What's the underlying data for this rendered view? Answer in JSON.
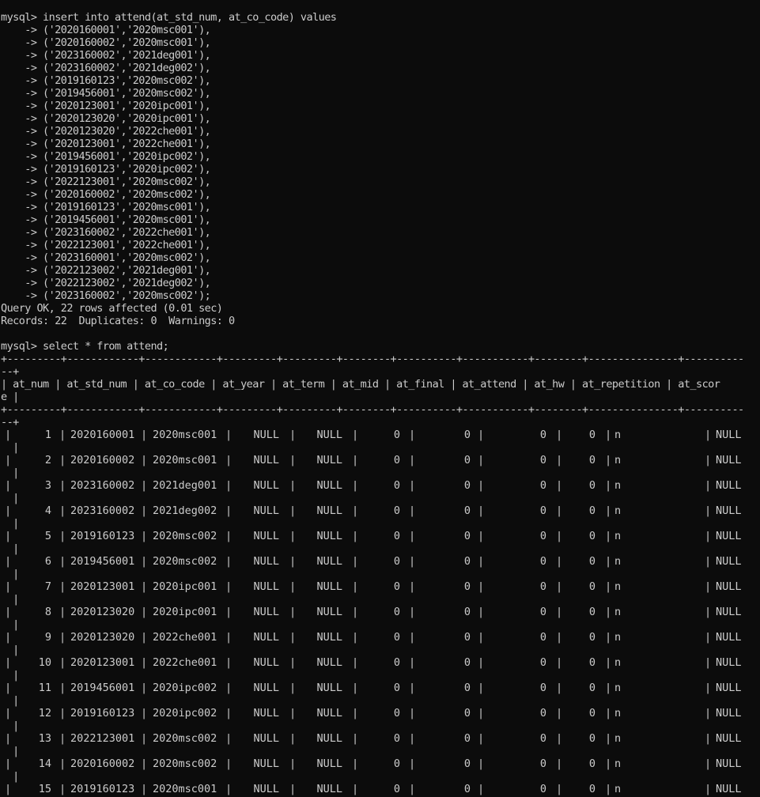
{
  "insert": {
    "prompt_line": "mysql> insert into attend(at_std_num, at_co_code) values",
    "value_lines": [
      "    -> ('2020160001','2020msc001'),",
      "    -> ('2020160002','2020msc001'),",
      "    -> ('2023160002','2021deg001'),",
      "    -> ('2023160002','2021deg002'),",
      "    -> ('2019160123','2020msc002'),",
      "    -> ('2019456001','2020msc002'),",
      "    -> ('2020123001','2020ipc001'),",
      "    -> ('2020123020','2020ipc001'),",
      "    -> ('2020123020','2022che001'),",
      "    -> ('2020123001','2022che001'),",
      "    -> ('2019456001','2020ipc002'),",
      "    -> ('2019160123','2020ipc002'),",
      "    -> ('2022123001','2020msc002'),",
      "    -> ('2020160002','2020msc002'),",
      "    -> ('2019160123','2020msc001'),",
      "    -> ('2019456001','2020msc001'),",
      "    -> ('2023160002','2022che001'),",
      "    -> ('2022123001','2022che001'),",
      "    -> ('2023160001','2020msc002'),",
      "    -> ('2022123002','2021deg001'),",
      "    -> ('2022123002','2021deg002'),",
      "    -> ('2023160002','2020msc002');"
    ],
    "result": "Query OK, 22 rows affected (0.01 sec)",
    "records": "Records: 22  Duplicates: 0  Warnings: 0"
  },
  "select": {
    "prompt_line": "mysql> select * from attend;",
    "border_line": "+---------+------------+------------+---------+---------+--------+----------+-----------+--------+---------------+----------",
    "border_wrap": "--+",
    "header_line": "| at_num | at_std_num | at_co_code | at_year | at_term | at_mid | at_final | at_attend | at_hw | at_repetition | at_scor",
    "header_wrap": "e |",
    "row_wrap": "  |",
    "rows": [
      [
        "1",
        "2020160001",
        "2020msc001",
        "NULL",
        "NULL",
        "0",
        "0",
        "0",
        "0",
        "n",
        "NULL"
      ],
      [
        "2",
        "2020160002",
        "2020msc001",
        "NULL",
        "NULL",
        "0",
        "0",
        "0",
        "0",
        "n",
        "NULL"
      ],
      [
        "3",
        "2023160002",
        "2021deg001",
        "NULL",
        "NULL",
        "0",
        "0",
        "0",
        "0",
        "n",
        "NULL"
      ],
      [
        "4",
        "2023160002",
        "2021deg002",
        "NULL",
        "NULL",
        "0",
        "0",
        "0",
        "0",
        "n",
        "NULL"
      ],
      [
        "5",
        "2019160123",
        "2020msc002",
        "NULL",
        "NULL",
        "0",
        "0",
        "0",
        "0",
        "n",
        "NULL"
      ],
      [
        "6",
        "2019456001",
        "2020msc002",
        "NULL",
        "NULL",
        "0",
        "0",
        "0",
        "0",
        "n",
        "NULL"
      ],
      [
        "7",
        "2020123001",
        "2020ipc001",
        "NULL",
        "NULL",
        "0",
        "0",
        "0",
        "0",
        "n",
        "NULL"
      ],
      [
        "8",
        "2020123020",
        "2020ipc001",
        "NULL",
        "NULL",
        "0",
        "0",
        "0",
        "0",
        "n",
        "NULL"
      ],
      [
        "9",
        "2020123020",
        "2022che001",
        "NULL",
        "NULL",
        "0",
        "0",
        "0",
        "0",
        "n",
        "NULL"
      ],
      [
        "10",
        "2020123001",
        "2022che001",
        "NULL",
        "NULL",
        "0",
        "0",
        "0",
        "0",
        "n",
        "NULL"
      ],
      [
        "11",
        "2019456001",
        "2020ipc002",
        "NULL",
        "NULL",
        "0",
        "0",
        "0",
        "0",
        "n",
        "NULL"
      ],
      [
        "12",
        "2019160123",
        "2020ipc002",
        "NULL",
        "NULL",
        "0",
        "0",
        "0",
        "0",
        "n",
        "NULL"
      ],
      [
        "13",
        "2022123001",
        "2020msc002",
        "NULL",
        "NULL",
        "0",
        "0",
        "0",
        "0",
        "n",
        "NULL"
      ],
      [
        "14",
        "2020160002",
        "2020msc002",
        "NULL",
        "NULL",
        "0",
        "0",
        "0",
        "0",
        "n",
        "NULL"
      ],
      [
        "15",
        "2019160123",
        "2020msc001",
        "NULL",
        "NULL",
        "0",
        "0",
        "0",
        "0",
        "n",
        "NULL"
      ]
    ]
  },
  "colors": {
    "background": "#0c0c0c",
    "text": "#cccccc"
  }
}
